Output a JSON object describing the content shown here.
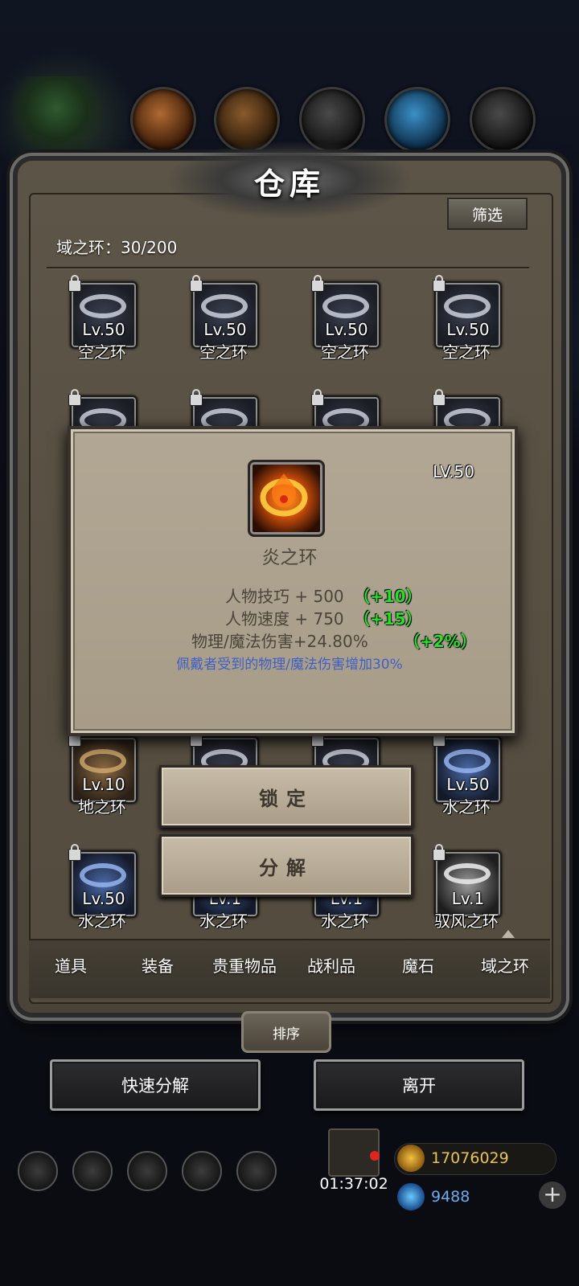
{
  "window": {
    "title": "仓库",
    "filter_label": "筛选"
  },
  "inventory": {
    "category_label": "域之环：30/200",
    "rows": [
      [
        {
          "lv": "Lv.50",
          "name": "空之环",
          "kind": "sky"
        },
        {
          "lv": "Lv.50",
          "name": "空之环",
          "kind": "sky"
        },
        {
          "lv": "Lv.50",
          "name": "空之环",
          "kind": "sky"
        },
        {
          "lv": "Lv.50",
          "name": "空之环",
          "kind": "sky"
        }
      ],
      [
        {
          "lv": "",
          "name": "",
          "kind": "sky"
        },
        {
          "lv": "",
          "name": "",
          "kind": "sky"
        },
        {
          "lv": "",
          "name": "",
          "kind": "sky"
        },
        {
          "lv": "",
          "name": "",
          "kind": "sky"
        }
      ],
      [
        {
          "lv": "Lv.10",
          "name": "地之环",
          "kind": "earth"
        },
        {
          "lv": "",
          "name": "",
          "kind": "sky"
        },
        {
          "lv": "",
          "name": "",
          "kind": "sky"
        },
        {
          "lv": "Lv.50",
          "name": "水之环",
          "kind": "water"
        }
      ],
      [
        {
          "lv": "Lv.50",
          "name": "水之环",
          "kind": "water"
        },
        {
          "lv": "Lv.1",
          "name": "水之环",
          "kind": "water"
        },
        {
          "lv": "Lv.1",
          "name": "水之环",
          "kind": "water"
        },
        {
          "lv": "Lv.1",
          "name": "驭风之环",
          "kind": "wind"
        }
      ]
    ]
  },
  "tooltip": {
    "level": "LV.50",
    "name": "炎之环",
    "stats": [
      {
        "label": "人物技巧 + 500",
        "bonus": "（+10）"
      },
      {
        "label": "人物速度 + 750",
        "bonus": "（+15）"
      },
      {
        "label": "物理/魔法伤害+24.80%",
        "bonus": "（+2%）"
      }
    ],
    "description": "佩戴者受到的物理/魔法伤害增加30%",
    "icon": "fire-ring-icon"
  },
  "actions": {
    "lock": "锁定",
    "decompose": "分解"
  },
  "tabs": [
    "道具",
    "装备",
    "贵重物品",
    "战利品",
    "魔石",
    "域之环"
  ],
  "sort_label": "排序",
  "buttons": {
    "quick_decompose": "快速分解",
    "leave": "离开"
  },
  "hud": {
    "timer": "01:37:02",
    "gold": "17076029",
    "gems": "9488",
    "plus": "+"
  },
  "colors": {
    "bonus_green": "#27e027",
    "desc_blue": "#3f5fc4",
    "panel_brown": "#5b5447"
  }
}
